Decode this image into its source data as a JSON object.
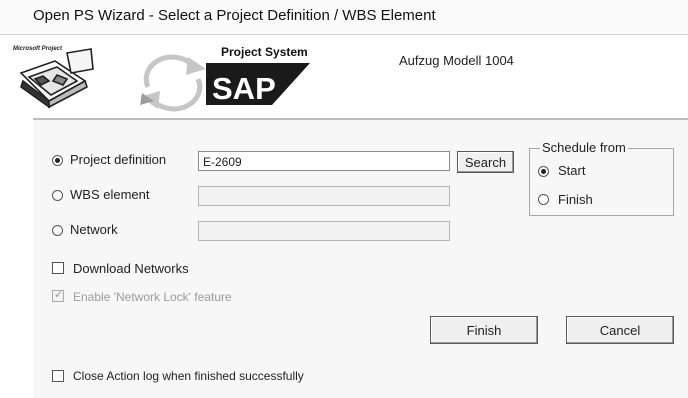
{
  "window": {
    "title": "Open PS Wizard - Select a Project Definition / WBS Element"
  },
  "banner": {
    "ms_project_label": "Microsoft Project",
    "project_system_label": "Project System",
    "sap_logo_text": "SAP",
    "project_name": "Aufzug Modell 1004"
  },
  "form": {
    "project_definition": {
      "label": "Project definition",
      "value": "E-2609",
      "checked": true
    },
    "wbs_element": {
      "label": "WBS element",
      "value": "",
      "checked": false
    },
    "network": {
      "label": "Network",
      "value": "",
      "checked": false
    },
    "search_button": "Search",
    "download_networks": {
      "label": "Download Networks",
      "checked": false
    },
    "network_lock": {
      "label": "Enable 'Network Lock' feature",
      "checked": true,
      "disabled": true
    },
    "close_action_log": {
      "label": "Close Action log when finished successfully",
      "checked": false
    }
  },
  "schedule_from": {
    "title": "Schedule from",
    "start": {
      "label": "Start",
      "checked": true
    },
    "finish": {
      "label": "Finish",
      "checked": false
    }
  },
  "buttons": {
    "finish": "Finish",
    "cancel": "Cancel"
  }
}
